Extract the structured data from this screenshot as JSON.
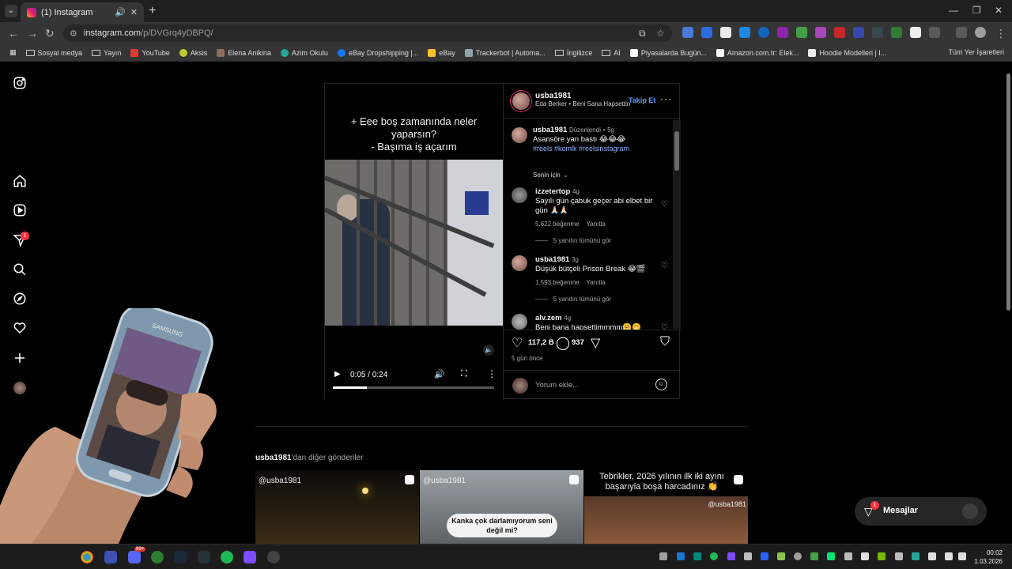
{
  "browser": {
    "tab_title": "(1) Instagram",
    "url_host": "instagram.com",
    "url_path": "/p/DVGrq4yDBPQ/",
    "bookmarks": [
      "Sosyal medya",
      "Yayın",
      "YouTube",
      "Aksis",
      "Elena Anikina",
      "Azim Okulu",
      "eBay Dropshipping |...",
      "eBay",
      "Trackerbot | Automa...",
      "İngilizce",
      "AI",
      "Piyasalarda Bugün...",
      "Amazon.com.tr: Elek...",
      "Hoodie Modelleri | I..."
    ],
    "bookmarks_right": "Tüm Yer İşaretleri"
  },
  "sidebar": {
    "notification_badge": "1"
  },
  "post": {
    "video_caption": "+ Eee boş zamanında neler yaparsın?\n- Başıma iş açarım",
    "video_time": "0:05 / 0:24",
    "video_progress": 0.21,
    "author": "usba1981",
    "audio": "Eda Berker • Beni Sana Hapsettin",
    "follow_label": "Takip Et",
    "caption": {
      "user": "usba1981",
      "edited": "Düzenlendi",
      "age": "5g",
      "text": "Asansöre yan bastı 😂😂😂",
      "tags": "#reels #komik #reelsinstagram"
    },
    "sort_label": "Senin için",
    "comments": [
      {
        "user": "izzetertop",
        "age": "4g",
        "text": "Sayılı gün çabuk geçer abi elbet bir gün 🙏🏻🙏🏻",
        "likes": "5.622 beğenme",
        "reply": "Yanıtla",
        "view_replies": "5 yanıtın tümünü gör"
      },
      {
        "user": "usba1981",
        "age": "3g",
        "text": "Düşük bütçeli Prison Break 😂🎬",
        "likes": "1.593 beğenme",
        "reply": "Yanıtla",
        "view_replies": "5 yanıtın tümünü gör"
      },
      {
        "user": "alv.zem",
        "age": "4g",
        "text": "Beni bana hapsettimmmm🤗🤭"
      }
    ],
    "likes_count": "117,2 B",
    "comments_count": "937",
    "posted_ago": "5 gün önce",
    "add_comment_placeholder": "Yorum ekle..."
  },
  "more_posts": {
    "user": "usba1981",
    "suffix": "'dan diğer gönderiler",
    "thumbs": [
      {
        "label": "@usba1981"
      },
      {
        "label": "@usba1981",
        "pill": "Kanka çok darlamıyorum seni değil mi?"
      },
      {
        "caption": "Tebrikler, 2026 yılının ilk iki ayını başarıyla boşa harcadınız 👏",
        "user": "@usba1981"
      }
    ]
  },
  "messages": {
    "label": "Mesajlar",
    "badge": "1"
  },
  "phone_brand": "SAMSUNG",
  "taskbar": {
    "time": "00:02",
    "date": "1.03.2026",
    "badge": "99+"
  }
}
